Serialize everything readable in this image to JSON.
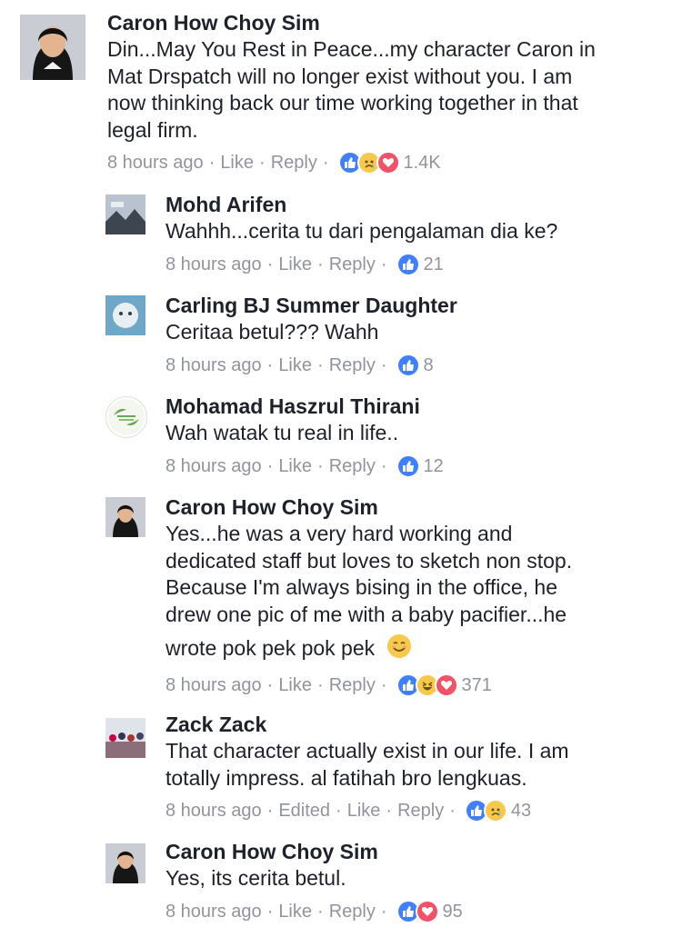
{
  "comments": [
    {
      "name": "Caron How Choy Sim",
      "lines": [
        "Din...May You Rest in Peace...my character Caron in",
        "Mat Drspatch will no longer exist without you.  I am",
        "now thinking back our time working together in that",
        "legal firm."
      ],
      "time": "8 hours ago",
      "like": "Like",
      "reply": "Reply",
      "reactions": [
        "like-icon",
        "sad-icon",
        "love-icon"
      ],
      "count": "1.4K"
    },
    {
      "name": "Mohd Arifen",
      "lines": [
        "Wahhh...cerita tu dari pengalaman dia ke?"
      ],
      "time": "8 hours ago",
      "like": "Like",
      "reply": "Reply",
      "reactions": [
        "like-icon"
      ],
      "count": "21"
    },
    {
      "name": "Carling BJ Summer Daughter",
      "lines": [
        "Ceritaa betul??? Wahh"
      ],
      "time": "8 hours ago",
      "like": "Like",
      "reply": "Reply",
      "reactions": [
        "like-icon"
      ],
      "count": "8"
    },
    {
      "name": "Mohamad Haszrul Thirani",
      "lines": [
        "Wah watak tu real in life.."
      ],
      "time": "8 hours ago",
      "like": "Like",
      "reply": "Reply",
      "reactions": [
        "like-icon"
      ],
      "count": "12"
    },
    {
      "name": "Caron How Choy Sim",
      "lines": [
        "Yes...he was a very hard working and",
        "dedicated staff but loves to sketch non stop.",
        "Because I'm always bising in the office, he",
        "drew one pic of me with a baby pacifier...he",
        "wrote pok pek pok pek"
      ],
      "time": "8 hours ago",
      "like": "Like",
      "reply": "Reply",
      "reactions": [
        "like-icon",
        "haha-icon",
        "love-icon"
      ],
      "count": "371"
    },
    {
      "name": "Zack Zack",
      "lines": [
        "That character actually exist in our life. I am",
        "totally impress. al fatihah bro lengkuas."
      ],
      "time": "8 hours ago",
      "edited": "Edited",
      "like": "Like",
      "reply": "Reply",
      "reactions": [
        "like-icon",
        "sad-icon"
      ],
      "count": "43"
    },
    {
      "name": "Caron How Choy Sim",
      "lines": [
        "Yes, its cerita betul."
      ],
      "time": "8 hours ago",
      "like": "Like",
      "reply": "Reply",
      "reactions": [
        "like-icon",
        "love-icon"
      ],
      "count": "95"
    }
  ],
  "meta_separator": "·"
}
